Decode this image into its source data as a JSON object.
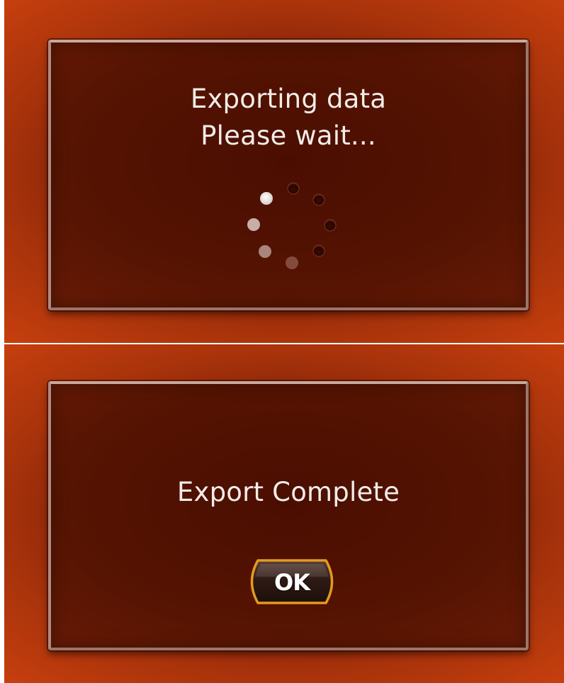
{
  "export_progress": {
    "line1": "Exporting data",
    "line2": "Please wait...",
    "spinner_icon": "loading-spinner-icon"
  },
  "export_complete": {
    "message": "Export Complete",
    "ok_label": "OK"
  },
  "colors": {
    "background": "#c9400e",
    "dialog": "#4a0e01",
    "dialog_border": "#a88174",
    "text": "#f2ece7",
    "button_border": "#e39a1e"
  }
}
